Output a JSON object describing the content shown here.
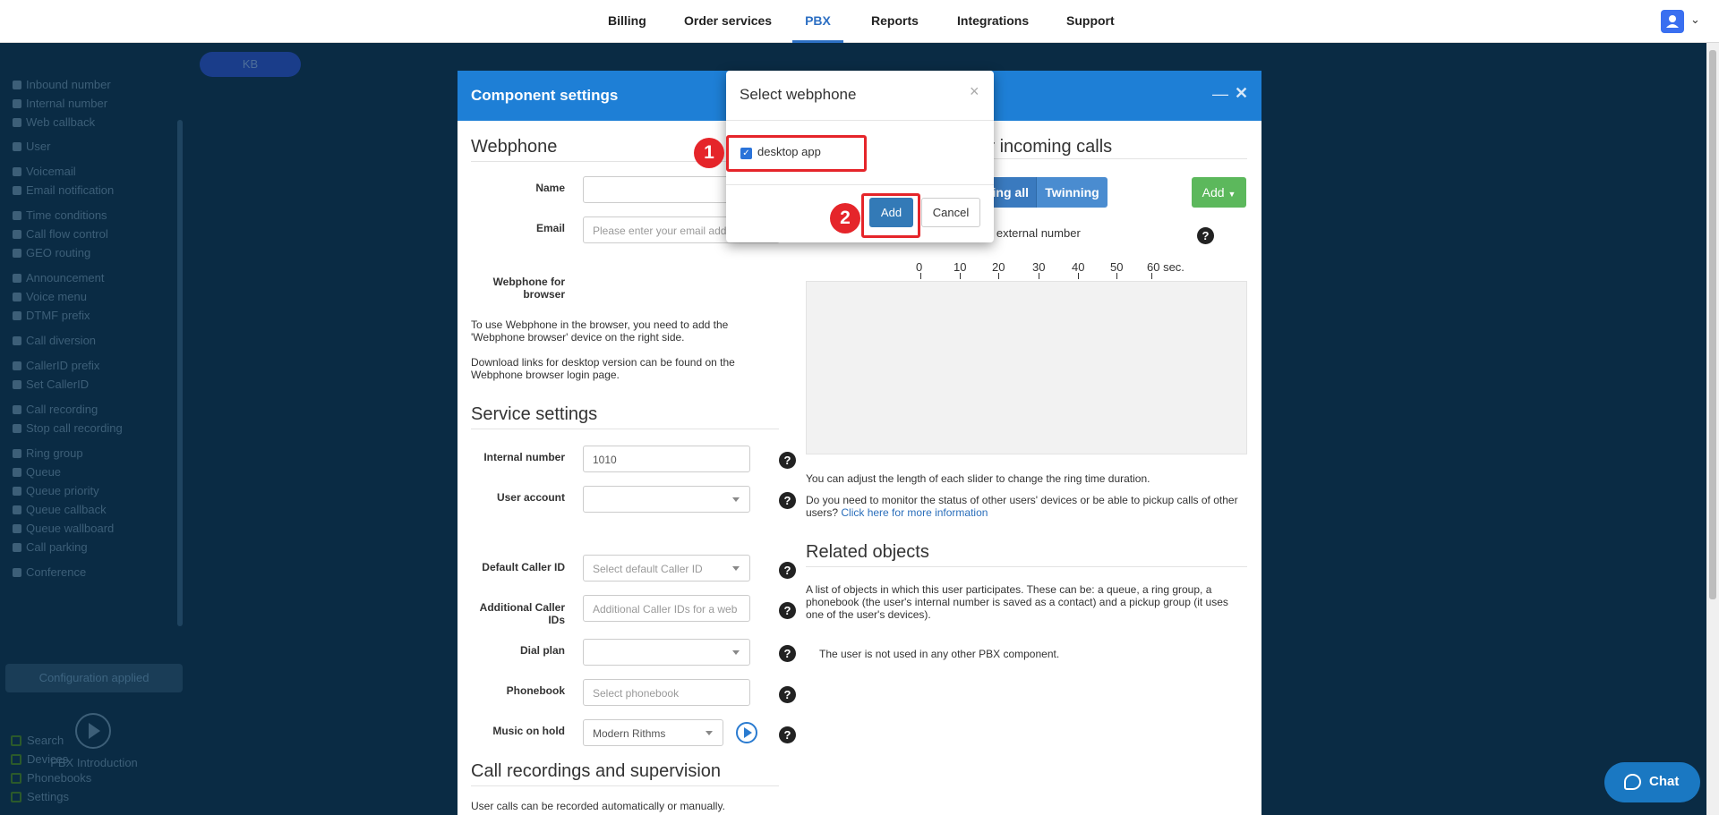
{
  "topnav": {
    "tabs": [
      {
        "label": "Billing"
      },
      {
        "label": "Order services"
      },
      {
        "label": "PBX"
      },
      {
        "label": "Reports"
      },
      {
        "label": "Integrations"
      },
      {
        "label": "Support"
      }
    ],
    "active_tab": "PBX"
  },
  "sidebar": {
    "items": [
      {
        "label": "Inbound number"
      },
      {
        "label": "Internal number"
      },
      {
        "label": "Web callback"
      },
      {
        "label": "User"
      },
      {
        "label": "Voicemail"
      },
      {
        "label": "Email notification"
      },
      {
        "label": "Time conditions"
      },
      {
        "label": "Call flow control"
      },
      {
        "label": "GEO routing"
      },
      {
        "label": "Announcement"
      },
      {
        "label": "Voice menu"
      },
      {
        "label": "DTMF prefix"
      },
      {
        "label": "Call diversion"
      },
      {
        "label": "CallerID prefix"
      },
      {
        "label": "Set CallerID"
      },
      {
        "label": "Call recording"
      },
      {
        "label": "Stop call recording"
      },
      {
        "label": "Ring group"
      },
      {
        "label": "Queue"
      },
      {
        "label": "Queue priority"
      },
      {
        "label": "Queue callback"
      },
      {
        "label": "Queue wallboard"
      },
      {
        "label": "Call parking"
      },
      {
        "label": "Conference"
      }
    ],
    "config_applied": "Configuration applied",
    "intro_label": "PBX Introduction",
    "links": [
      {
        "label": "Search"
      },
      {
        "label": "Devices"
      },
      {
        "label": "Phonebooks"
      },
      {
        "label": "Settings"
      }
    ]
  },
  "kb_button": "KB",
  "panel": {
    "title": "Component settings",
    "webphone_title": "Webphone",
    "name_label": "Name",
    "email_label": "Email",
    "email_placeholder": "Please enter your email add",
    "webphone_browser_label": "Webphone for browser",
    "webphone_info_1": "To use Webphone in the browser, you need to add the 'Webphone browser' device on the right side.",
    "webphone_info_2": "Download links for desktop version can be found on the Webphone browser login page.",
    "service_title": "Service settings",
    "internal_number_label": "Internal number",
    "internal_number_value": "1010",
    "user_account_label": "User account",
    "default_callerid_label": "Default Caller ID",
    "default_callerid_placeholder": "Select default Caller ID",
    "additional_callerid_label": "Additional Caller IDs",
    "additional_callerid_placeholder": "Additional Caller IDs for a web",
    "dial_plan_label": "Dial plan",
    "phonebook_label": "Phonebook",
    "phonebook_placeholder": "Select phonebook",
    "moh_label": "Music on hold",
    "moh_value": "Modern Rithms",
    "call_rec_title": "Call recordings and supervision",
    "call_rec_text": "User calls can be recorded automatically or manually.",
    "incoming_title": "g for incoming calls",
    "ring_all_label": "ing all",
    "twinning_label": "Twinning",
    "add_label": "Add",
    "external_number_text": "n external number",
    "ring_ticks": [
      "0",
      "10",
      "20",
      "30",
      "40",
      "50",
      "60 sec."
    ],
    "slider_info": "You can adjust the length of each slider to change the ring time duration.",
    "monitor_info": "Do you need to monitor the status of other users' devices or be able to pickup calls of other users?",
    "monitor_link": "Click here for more information",
    "related_title": "Related objects",
    "related_info": "A list of objects in which this user participates. These can be: a queue, a ring group, a phonebook (the user's internal number is saved as a contact) and a pickup group (it uses one of the user's devices).",
    "related_empty": "The user is not used in any other PBX component."
  },
  "dialog": {
    "title": "Select webphone",
    "option_label": "desktop app",
    "option_checked": true,
    "add_label": "Add",
    "cancel_label": "Cancel"
  },
  "annotations": {
    "step1": "1",
    "step2": "2",
    "color": "#e5252a"
  },
  "chat": {
    "label": "Chat"
  },
  "colors": {
    "panel_header": "#1e7fd6",
    "sidebar_bg": "#0a2b44",
    "primary_button": "#337ab7",
    "add_green": "#5cb85c"
  }
}
